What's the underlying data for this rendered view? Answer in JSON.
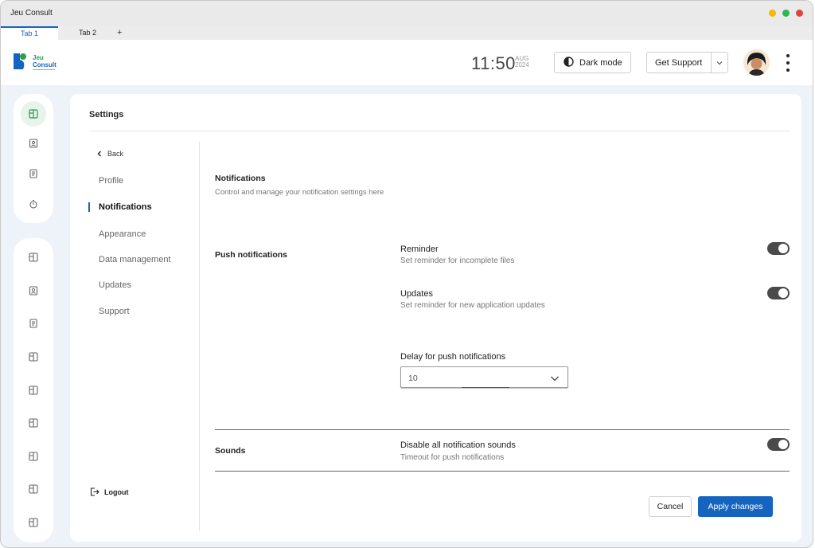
{
  "window": {
    "app_title": "Jeu Consult",
    "controls": [
      "minimize",
      "maximize",
      "close"
    ],
    "control_colors": [
      "#f5b800",
      "#2fb84a",
      "#e0443e"
    ]
  },
  "tabs": {
    "items": [
      {
        "label": "Tab 1",
        "active": true
      },
      {
        "label": "Tab 2",
        "active": false
      }
    ],
    "add_label": "+"
  },
  "header": {
    "logo_text_1": "Jeu",
    "logo_text_2": "Consult",
    "time": "11:50",
    "date_month": "AUG",
    "date_year": "2024",
    "dark_mode_label": "Dark mode",
    "support_label": "Get Support",
    "avatar_icon": "user-avatar",
    "more_icon": "kebab-menu-icon"
  },
  "rail": {
    "top_icons": [
      "dashboard-icon",
      "contacts-icon",
      "document-icon",
      "timer-icon"
    ],
    "bottom_icons": [
      "dashboard-icon",
      "contacts-icon",
      "document-icon",
      "dashboard-icon",
      "dashboard-icon",
      "dashboard-icon",
      "dashboard-icon",
      "dashboard-icon",
      "dashboard-icon"
    ],
    "active_index": 0,
    "accent": "#2e9b4f"
  },
  "settings": {
    "title": "Settings",
    "back_label": "Back",
    "nav": [
      {
        "label": "Profile",
        "active": false
      },
      {
        "label": "Notifications",
        "active": true
      },
      {
        "label": "Appearance",
        "active": false
      },
      {
        "label": "Data management",
        "active": false
      },
      {
        "label": "Updates",
        "active": false
      },
      {
        "label": "Support",
        "active": false
      }
    ],
    "logout_label": "Logout"
  },
  "notifications": {
    "title": "Notifications",
    "subtitle": "Control and manage your notification settings here",
    "push": {
      "title": "Push notifications",
      "items": [
        {
          "label": "Reminder",
          "desc": "Set reminder for incomplete files",
          "enabled": true
        },
        {
          "label": "Updates",
          "desc": "Set reminder for new application updates",
          "enabled": true
        }
      ],
      "delay_label": "Delay for push notifications",
      "delay_value": "10"
    },
    "sounds": {
      "title": "Sounds",
      "label": "Disable all notification sounds",
      "desc": "Timeout for push notifications",
      "enabled": true
    }
  },
  "actions": {
    "cancel_label": "Cancel",
    "apply_label": "Apply changes",
    "primary_color": "#1565c0"
  }
}
